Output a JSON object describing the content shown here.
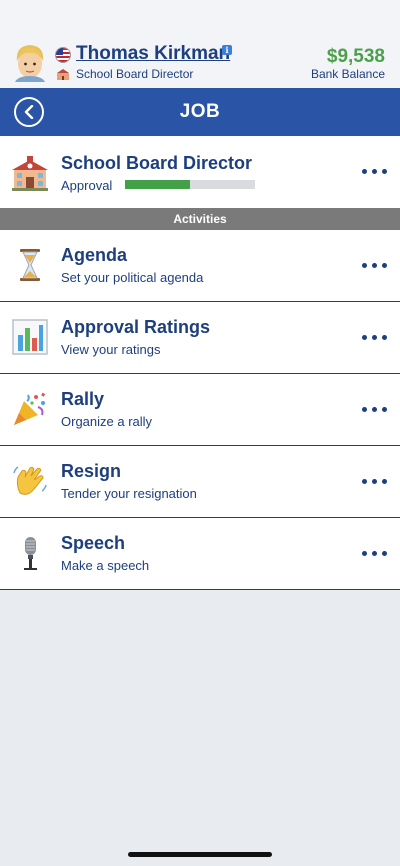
{
  "profile": {
    "name": "Thomas Kirkman",
    "job_title": "School Board Director",
    "balance": "$9,538",
    "balance_label": "Bank Balance"
  },
  "header": {
    "title": "JOB"
  },
  "job": {
    "title": "School Board Director",
    "approval_label": "Approval",
    "approval_fraction": 0.5
  },
  "section": {
    "label": "Activities"
  },
  "activities": [
    {
      "title": "Agenda",
      "subtitle": "Set your political agenda",
      "icon": "hourglass-icon"
    },
    {
      "title": "Approval Ratings",
      "subtitle": "View your ratings",
      "icon": "bar-chart-icon"
    },
    {
      "title": "Rally",
      "subtitle": "Organize a rally",
      "icon": "party-popper-icon"
    },
    {
      "title": "Resign",
      "subtitle": "Tender your resignation",
      "icon": "waving-hand-icon"
    },
    {
      "title": "Speech",
      "subtitle": "Make a speech",
      "icon": "microphone-icon"
    }
  ],
  "colors": {
    "navy_text": "#1e3f7e",
    "header_blue": "#2a55a6",
    "money_green": "#4ca04a",
    "approval_green": "#43a047",
    "section_gray": "#7a7a7a",
    "background": "#e8ebf0"
  }
}
